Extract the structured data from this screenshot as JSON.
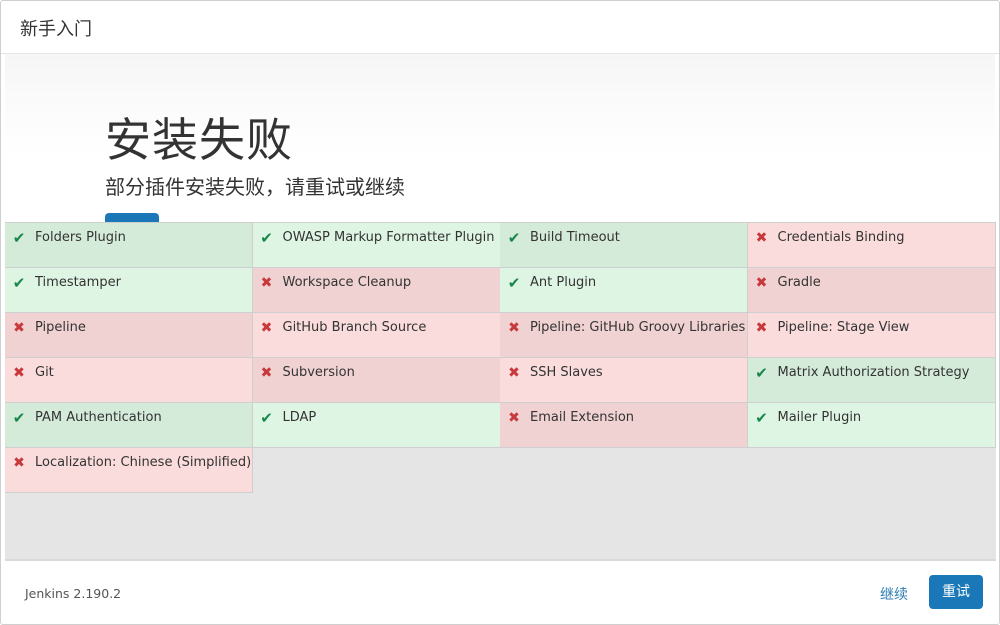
{
  "header": {
    "title": "新手入门"
  },
  "hero": {
    "title": "安装失败",
    "subtitle": "部分插件安装失败，请重试或继续"
  },
  "status_colors": {
    "success": "#d4ebd9",
    "failure": "#f1d2d2",
    "accent": "#1a77b8"
  },
  "plugins": [
    {
      "label": "Folders Plugin",
      "status": "success",
      "icon": "check-icon"
    },
    {
      "label": "OWASP Markup Formatter Plugin",
      "status": "success",
      "icon": "check-icon"
    },
    {
      "label": "Build Timeout",
      "status": "success",
      "icon": "check-icon"
    },
    {
      "label": "Credentials Binding",
      "status": "failure",
      "icon": "cross-icon"
    },
    {
      "label": "Timestamper",
      "status": "success",
      "icon": "check-icon"
    },
    {
      "label": "Workspace Cleanup",
      "status": "failure",
      "icon": "cross-icon"
    },
    {
      "label": "Ant Plugin",
      "status": "success",
      "icon": "check-icon"
    },
    {
      "label": "Gradle",
      "status": "failure",
      "icon": "cross-icon"
    },
    {
      "label": "Pipeline",
      "status": "failure",
      "icon": "cross-icon"
    },
    {
      "label": "GitHub Branch Source",
      "status": "failure",
      "icon": "cross-icon"
    },
    {
      "label": "Pipeline: GitHub Groovy Libraries",
      "status": "failure",
      "icon": "cross-icon"
    },
    {
      "label": "Pipeline: Stage View",
      "status": "failure",
      "icon": "cross-icon"
    },
    {
      "label": "Git",
      "status": "failure",
      "icon": "cross-icon"
    },
    {
      "label": "Subversion",
      "status": "failure",
      "icon": "cross-icon"
    },
    {
      "label": "SSH Slaves",
      "status": "failure",
      "icon": "cross-icon"
    },
    {
      "label": "Matrix Authorization Strategy",
      "status": "success",
      "icon": "check-icon"
    },
    {
      "label": "PAM Authentication",
      "status": "success",
      "icon": "check-icon"
    },
    {
      "label": "LDAP",
      "status": "success",
      "icon": "check-icon"
    },
    {
      "label": "Email Extension",
      "status": "failure",
      "icon": "cross-icon"
    },
    {
      "label": "Mailer Plugin",
      "status": "success",
      "icon": "check-icon"
    },
    {
      "label": "Localization: Chinese (Simplified)",
      "status": "failure",
      "icon": "cross-icon"
    }
  ],
  "footer": {
    "version": "Jenkins 2.190.2",
    "continue_label": "继续",
    "retry_label": "重试"
  }
}
